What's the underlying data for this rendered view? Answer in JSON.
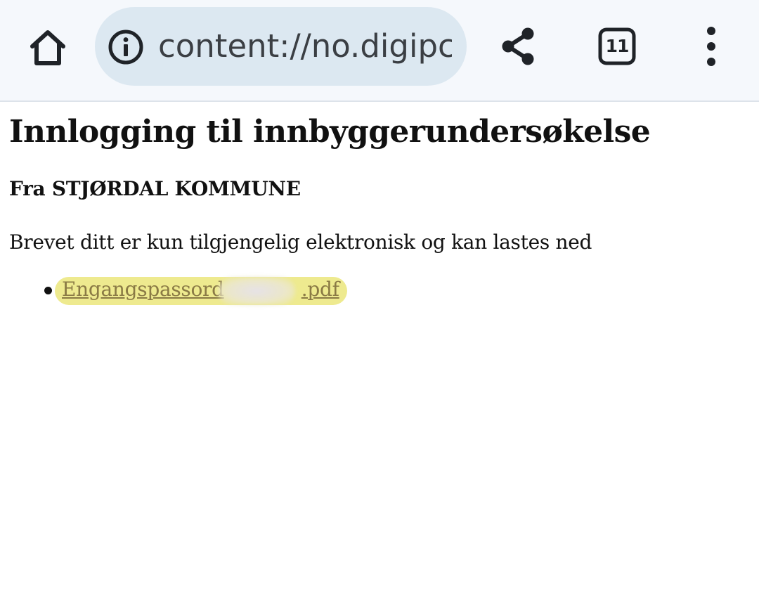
{
  "browser": {
    "home_icon": "home-icon",
    "info_icon": "info-icon",
    "url": "content://no.digipc",
    "share_icon": "share-icon",
    "tab_count": "11",
    "menu_icon": "more-vertical-icon"
  },
  "page": {
    "title": "Innlogging til innbyggerundersøkelse",
    "sender": "Fra STJØRDAL KOMMUNE",
    "message": "Brevet ditt er kun tilgjengelig elektronisk og kan lastes ned",
    "files": [
      {
        "name_start": "Engangspassord",
        "name_end": ".pdf",
        "highlight_color": "#eeea8f"
      }
    ]
  },
  "colors": {
    "toolbar_bg": "#f5f8fc",
    "omnibox_bg": "#dce8f1",
    "link_color": "#8a7a45"
  }
}
